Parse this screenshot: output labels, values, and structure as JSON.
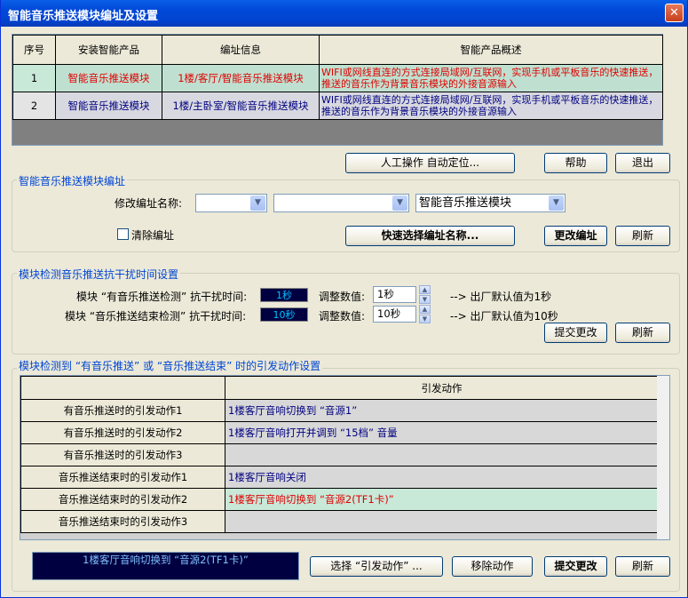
{
  "window": {
    "title": "智能音乐推送模块编址及设置",
    "close": "✕"
  },
  "grid1": {
    "headers": [
      "序号",
      "安装智能产品",
      "编址信息",
      "智能产品概述"
    ],
    "rows": [
      {
        "no": "1",
        "product": "智能音乐推送模块",
        "address": "1楼/客厅/智能音乐推送模块",
        "desc": "WIFI或网线直连的方式连接局域网/互联网，实现手机或平板音乐的快速推送，推送的音乐作为背景音乐模块的外接音源输入"
      },
      {
        "no": "2",
        "product": "智能音乐推送模块",
        "address": "1楼/主卧室/智能音乐推送模块",
        "desc": "WIFI或网线直连的方式连接局域网/互联网，实现手机或平板音乐的快速推送，推送的音乐作为背景音乐模块的外接音源输入"
      }
    ]
  },
  "top_buttons": {
    "manual": "人工操作   自动定位...",
    "help": "帮助",
    "exit": "退出"
  },
  "edit_group": {
    "title": "智能音乐推送模块编址",
    "name_label": "修改编址名称:",
    "combo1": "",
    "combo2": "",
    "combo3": "智能音乐推送模块",
    "clear_label": "清除编址",
    "quick_select": "快速选择编址名称...",
    "change": "更改编址",
    "refresh": "刷新"
  },
  "timing_group": {
    "title": "模块检测音乐推送抗干扰时间设置",
    "row1_label": "模块 “有音乐推送检测” 抗干扰时间:",
    "row1_lcd": "1秒",
    "row1_adj_label": "调整数值:",
    "row1_value": "1秒",
    "row1_note": "--> 出厂默认值为1秒",
    "row2_label": "模块 “音乐推送结束检测” 抗干扰时间:",
    "row2_lcd": "10秒",
    "row2_adj_label": "调整数值:",
    "row2_value": "10秒",
    "row2_note": "--> 出厂默认值为10秒",
    "submit": "提交更改",
    "refresh": "刷新"
  },
  "action_group": {
    "title": "模块检测到 “有音乐推送” 或 “音乐推送结束” 时的引发动作设置",
    "header": "引发动作",
    "rows": [
      {
        "label": "有音乐推送时的引发动作1",
        "action": "1楼客厅音响切换到 “音源1”"
      },
      {
        "label": "有音乐推送时的引发动作2",
        "action": "1楼客厅音响打开并调到 “15档” 音量"
      },
      {
        "label": "有音乐推送时的引发动作3",
        "action": ""
      },
      {
        "label": "音乐推送结束时的引发动作1",
        "action": "1楼客厅音响关闭"
      },
      {
        "label": "音乐推送结束时的引发动作2",
        "action": "1楼客厅音响切换到 “音源2(TF1卡)”"
      },
      {
        "label": "音乐推送结束时的引发动作3",
        "action": ""
      }
    ],
    "status": "1楼客厅音响切换到 “音源2(TF1卡)”",
    "select_action": "选择 “引发动作” ...",
    "remove_action": "移除动作",
    "submit": "提交更改",
    "refresh": "刷新"
  }
}
